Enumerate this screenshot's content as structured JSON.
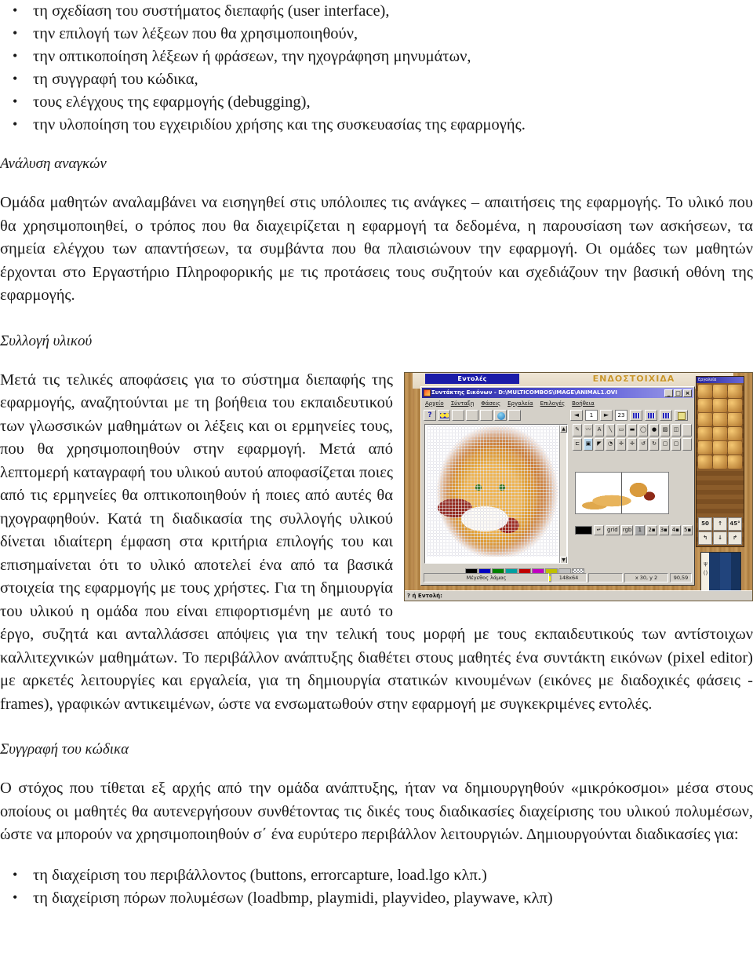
{
  "document": {
    "top_bullets": [
      "τη σχεδίαση του συστήματος διεπαφής (user interface),",
      "την επιλογή των λέξεων που θα χρησιμοποιηθούν,",
      "την οπτικοποίηση λέξεων ή φράσεων, την ηχογράφηση μηνυμάτων,",
      "τη συγγραφή του κώδικα,",
      "τους ελέγχους της εφαρμογής (debugging),",
      "την υλοποίηση του εγχειριδίου χρήσης και  της συσκευασίας της εφαρμογής."
    ],
    "heading_needs": "Ανάλυση αναγκών",
    "para_needs": "Ομάδα μαθητών αναλαμβάνει να εισηγηθεί στις υπόλοιπες τις ανάγκες – απαιτήσεις της εφαρμογής. Το υλικό που θα χρησιμοποιηθεί, ο τρόπος που θα διαχειρίζεται η εφαρμογή τα δεδομένα, η παρουσίαση των ασκήσεων, τα σημεία ελέγχου των απαντήσεων, τα συμβάντα που θα πλαισιώνουν την εφαρμογή. Οι ομάδες των μαθητών έρχονται στο Εργαστήριο Πληροφορικής με τις προτάσεις τους συζητούν και σχεδιάζουν την βασική οθόνη της εφαρμογής.",
    "heading_collection": "Συλλογή υλικού",
    "para_collection": "Μετά τις τελικές αποφάσεις για το σύστημα διεπαφής της εφαρμογής, αναζητούνται με τη βοήθεια του εκπαιδευτικού των γλωσσικών μαθημάτων οι λέξεις και οι ερμηνείες τους, που θα χρησιμοποιηθούν στην εφαρμογή.  Μετά από λεπτομερή καταγραφή του υλικού αυτού αποφασίζεται ποιες από τις ερμηνείες θα οπτικοποιηθούν ή ποιες από αυτές θα ηχογραφηθούν. Κατά τη διαδικασία της συλλογής υλικού δίνεται ιδιαίτερη έμφαση στα κριτήρια επιλογής του και επισημαίνεται ότι το υλικό αποτελεί ένα από τα βασικά στοιχεία της εφαρμογής με τους χρήστες. Για τη δημιουργία του υλικού η ομάδα που είναι επιφορτισμένη με αυτό το έργο, συζητά και ανταλλάσσει απόψεις για την τελική τους μορφή με τους εκπαιδευτικούς των αντίστοιχων καλλιτεχνικών μαθημάτων. Το περιβάλλον ανάπτυξης διαθέτει στους μαθητές ένα συντάκτη εικόνων (pixel editor) με αρκετές λειτουργίες και εργαλεία, για τη δημιουργία στατικών  κινουμένων (εικόνες με διαδοχικές φάσεις - frames), γραφικών αντικειμένων, ώστε να ενσωματωθούν στην εφαρμογή με συγκεκριμένες εντολές.",
    "heading_code": "Συγγραφή του κώδικα",
    "para_code": "Ο στόχος που τίθεται εξ αρχής από την ομάδα ανάπτυξης, ήταν να δημιουργηθούν «μικρόκοσμοι» μέσα στους οποίους οι μαθητές θα αυτενεργήσουν συνθέτοντας τις δικές τους διαδικασίες διαχείρισης του υλικού πολυμέσων, ώστε να μπορούν να χρησιμοποιηθούν σ΄ ένα ευρύτερο περιβάλλον λειτουργιών. Δημιουργούνται διαδικασίες για:",
    "bottom_bullets": [
      "τη διαχείριση του περιβάλλοντος (buttons, errorcapture, load.lgo κλπ.)",
      "τη διαχείριση πόρων πολυμέσων (loadbmp, playmidi, playvideo, playwave, κλπ)"
    ]
  },
  "screenshot": {
    "banner_label": "Εντολές",
    "wall_label": "ΕΝΔΟΣΤΟΙΧΙΔΑ",
    "window": {
      "title": "Συντάκτης Εικόνων - D:\\MULTICOMBOS\\IMAGE\\ANIMAL1.OVI",
      "min_label": "_",
      "max_label": "□",
      "close_label": "×",
      "menu": [
        "Αρχείο",
        "Σύνταξη",
        "Φάσεις",
        "Εργαλεία",
        "Επιλογές",
        "Βοήθεια"
      ],
      "toolbar_buttons": [
        "help-button",
        "color-button",
        "zoom-button",
        "blank-1",
        "blank-2",
        "globe-button",
        "blank-3"
      ],
      "frame_controls": {
        "prev_label": "◄",
        "frame_value": "1",
        "next_label": "►",
        "total_value": "23",
        "grid_toggle": "grid-toggle",
        "layer_a": "layer-a",
        "layer_b": "layer-b",
        "save_label": "save"
      },
      "tools_row1": [
        "pencil",
        "line-freehand",
        "A",
        "line",
        "rect",
        "rect-filled",
        "ellipse",
        "ellipse-filled",
        "fill-bucket",
        "mirror"
      ],
      "tools_row2": [
        "select-left",
        "select-box",
        "bucket",
        "spray",
        "move-1",
        "move-2",
        "rotate-1",
        "rotate-2",
        "frame-1",
        "frame-2"
      ],
      "palette_colors_row1": [
        "#000000",
        "#0000c0",
        "#008000",
        "#00a0a0",
        "#c00000",
        "#c000c0",
        "#c0c000",
        "#c0c0c0"
      ],
      "palette_colors_row2": [
        "#808080",
        "#0000ff",
        "#00ff00",
        "#00ffff",
        "#ff0000",
        "#ff00ff",
        "#ffff00",
        "#ffffff"
      ],
      "minitools": {
        "swatch": "#000000",
        "buttons": [
          "↵",
          "grid",
          "rgb",
          "1",
          "2▪",
          "3▪",
          "4▪",
          "5▪"
        ]
      },
      "status": {
        "hint": "Μέγεθος λάμας",
        "size": "148x64",
        "empty": "",
        "coords": "x 30, y 2",
        "zoom": "90,59"
      }
    },
    "board": {
      "title": "Εργαλεία",
      "number_buttons": [
        "50",
        "↑",
        "45°",
        "↰",
        "↓",
        "↱"
      ],
      "icon_count": 18
    },
    "taskbar": {
      "start_label": "? ή Εντολή:"
    }
  }
}
